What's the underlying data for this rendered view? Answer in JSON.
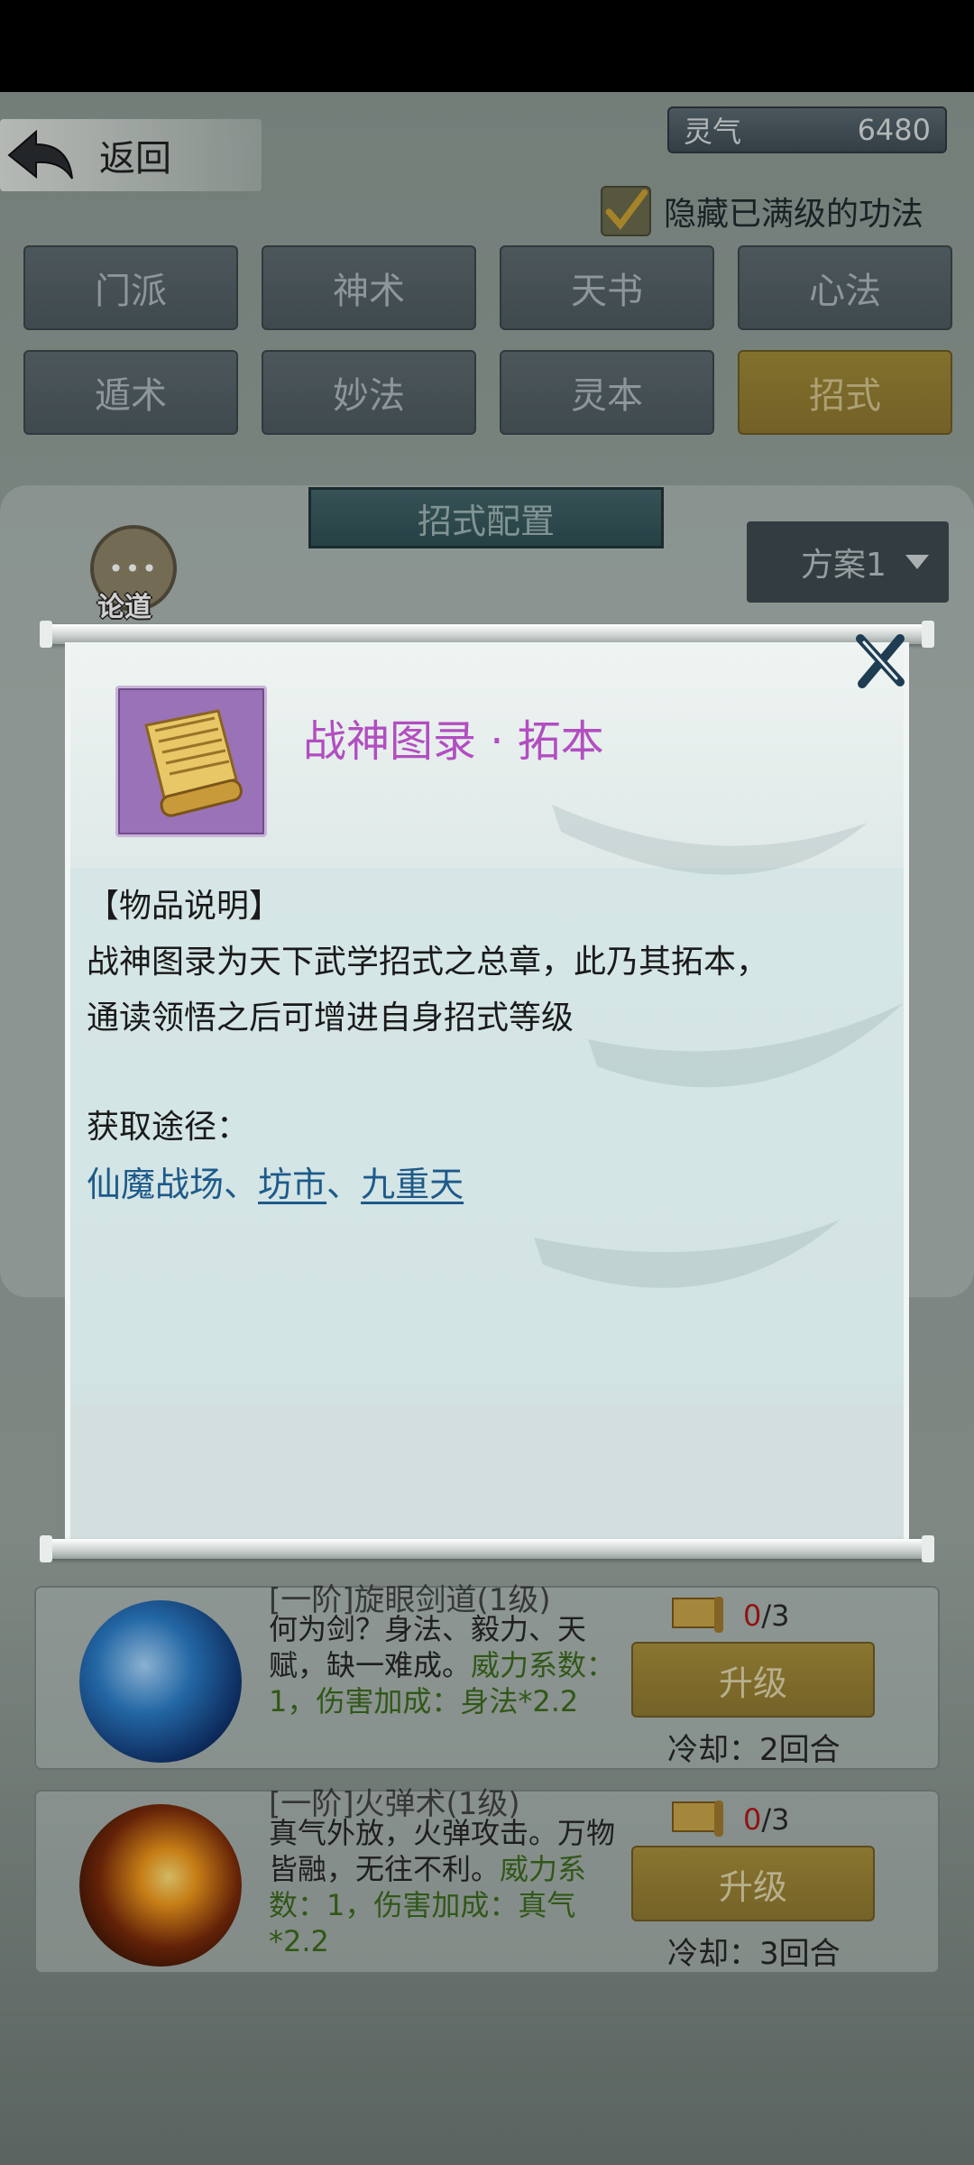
{
  "header": {
    "back_label": "返回",
    "spirit_label": "灵气",
    "spirit_value": "6480",
    "hide_maxed_label": "隐藏已满级的功法"
  },
  "tabs": [
    {
      "label": "门派",
      "active": false
    },
    {
      "label": "神术",
      "active": false
    },
    {
      "label": "天书",
      "active": false
    },
    {
      "label": "心法",
      "active": false
    },
    {
      "label": "遁术",
      "active": false
    },
    {
      "label": "妙法",
      "active": false
    },
    {
      "label": "灵本",
      "active": false
    },
    {
      "label": "招式",
      "active": true
    }
  ],
  "config": {
    "title": "招式配置",
    "plan_label": "方案1",
    "chat_label": "论道"
  },
  "skills": [
    {
      "title": "[一阶]旋眼剑道(1级)",
      "desc_plain": "何为剑？身法、毅力、天赋，缺一难成。",
      "desc_power": "威力系数：1，伤害加成：身法*2.2",
      "count_have": "0",
      "count_total": "/3",
      "upgrade_label": "升级",
      "cooldown": "冷却：2回合"
    },
    {
      "title": "[一阶]火弹术(1级)",
      "desc_plain": "真气外放，火弹攻击。万物皆融，无往不利。",
      "desc_power": "威力系数：1，伤害加成：真气*2.2",
      "count_have": "0",
      "count_total": "/3",
      "upgrade_label": "升级",
      "cooldown": "冷却：3回合"
    }
  ],
  "modal": {
    "item_name": "战神图录 · 拓本",
    "section_title": "【物品说明】",
    "desc_line1": "战神图录为天下武学招式之总章，此乃其拓本，",
    "desc_line2": "通读领悟之后可增进自身招式等级",
    "obtain_label": "获取途径：",
    "obtain_links": [
      "仙魔战场",
      "坊市",
      "九重天"
    ],
    "separator": "、"
  }
}
